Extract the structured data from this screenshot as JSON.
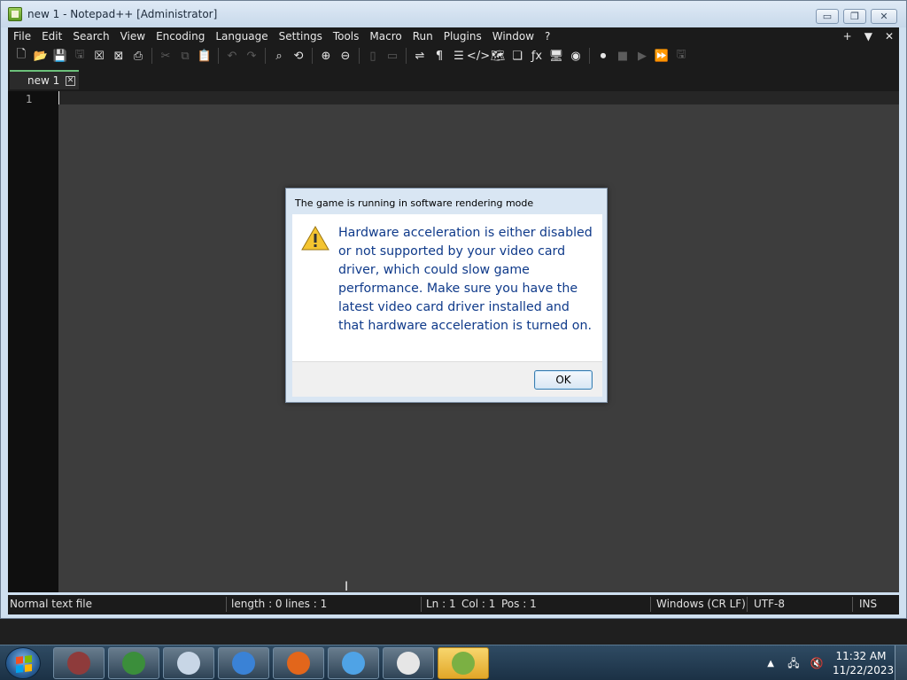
{
  "window": {
    "title": "new 1 - Notepad++ [Administrator]",
    "minimize_glyph": "▭",
    "restore_glyph": "❐",
    "close_glyph": "✕"
  },
  "menu": {
    "items": [
      "File",
      "Edit",
      "Search",
      "View",
      "Encoding",
      "Language",
      "Settings",
      "Tools",
      "Macro",
      "Run",
      "Plugins",
      "Window",
      "?"
    ],
    "right_items": [
      "+",
      "▼",
      "✕"
    ]
  },
  "toolbar": {
    "icons": [
      {
        "name": "new-file-icon",
        "glyph": "🗋",
        "dim": false
      },
      {
        "name": "open-file-icon",
        "glyph": "📂",
        "dim": false
      },
      {
        "name": "save-icon",
        "glyph": "💾",
        "dim": true
      },
      {
        "name": "save-all-icon",
        "glyph": "🖫",
        "dim": true
      },
      {
        "name": "close-icon",
        "glyph": "☒",
        "dim": false
      },
      {
        "name": "close-all-icon",
        "glyph": "⊠",
        "dim": false
      },
      {
        "name": "print-icon",
        "glyph": "⎙",
        "dim": false
      },
      {
        "name": "sep",
        "glyph": "",
        "dim": false
      },
      {
        "name": "cut-icon",
        "glyph": "✂",
        "dim": true
      },
      {
        "name": "copy-icon",
        "glyph": "⧉",
        "dim": true
      },
      {
        "name": "paste-icon",
        "glyph": "📋",
        "dim": true
      },
      {
        "name": "sep",
        "glyph": "",
        "dim": false
      },
      {
        "name": "undo-icon",
        "glyph": "↶",
        "dim": true
      },
      {
        "name": "redo-icon",
        "glyph": "↷",
        "dim": true
      },
      {
        "name": "sep",
        "glyph": "",
        "dim": false
      },
      {
        "name": "find-icon",
        "glyph": "⌕",
        "dim": false
      },
      {
        "name": "replace-icon",
        "glyph": "⟲",
        "dim": false
      },
      {
        "name": "sep",
        "glyph": "",
        "dim": false
      },
      {
        "name": "zoom-in-icon",
        "glyph": "⊕",
        "dim": false
      },
      {
        "name": "zoom-out-icon",
        "glyph": "⊖",
        "dim": false
      },
      {
        "name": "sep",
        "glyph": "",
        "dim": false
      },
      {
        "name": "sync-vertical-icon",
        "glyph": "▯",
        "dim": true
      },
      {
        "name": "sync-horizontal-icon",
        "glyph": "▭",
        "dim": true
      },
      {
        "name": "sep",
        "glyph": "",
        "dim": false
      },
      {
        "name": "word-wrap-icon",
        "glyph": "⇌",
        "dim": false
      },
      {
        "name": "show-all-chars-icon",
        "glyph": "¶",
        "dim": false
      },
      {
        "name": "indent-guide-icon",
        "glyph": "☰",
        "dim": false
      },
      {
        "name": "xml-tag-icon",
        "glyph": "</>",
        "dim": false
      },
      {
        "name": "document-map-icon",
        "glyph": "🗺",
        "dim": false
      },
      {
        "name": "document-list-icon",
        "glyph": "❏",
        "dim": false
      },
      {
        "name": "function-list-icon",
        "glyph": "ƒx",
        "dim": false
      },
      {
        "name": "folder-workspace-icon",
        "glyph": "🖥",
        "dim": false
      },
      {
        "name": "monitoring-icon",
        "glyph": "◉",
        "dim": false
      },
      {
        "name": "sep",
        "glyph": "",
        "dim": false
      },
      {
        "name": "record-macro-icon",
        "glyph": "⏺",
        "dim": false
      },
      {
        "name": "stop-macro-icon",
        "glyph": "■",
        "dim": true
      },
      {
        "name": "play-macro-icon",
        "glyph": "▶",
        "dim": true
      },
      {
        "name": "run-macro-multiple-icon",
        "glyph": "⏩",
        "dim": false
      },
      {
        "name": "save-macro-icon",
        "glyph": "🖫",
        "dim": true
      }
    ]
  },
  "tab": {
    "label": "new 1",
    "close_glyph": "✕"
  },
  "editor": {
    "line_number": "1",
    "cursor_glyph": "I"
  },
  "status": {
    "file_type": "Normal text file",
    "length": "length : 0",
    "lines": "lines : 1",
    "ln": "Ln : 1",
    "col": "Col : 1",
    "pos": "Pos : 1",
    "eol": "Windows (CR LF)",
    "encoding": "UTF-8",
    "mode": "INS"
  },
  "dialog": {
    "title": "The game is running in software rendering mode",
    "message": "Hardware acceleration is either disabled or not supported by your video card driver, which could slow game performance. Make sure you have the latest video card driver installed and that hardware acceleration is turned on.",
    "ok_label": "OK",
    "icon": "warning-icon"
  },
  "taskbar": {
    "apps": [
      {
        "name": "winrar-taskbar-icon",
        "color": "#8e3b3b",
        "active": false
      },
      {
        "name": "chrome-taskbar-icon",
        "color": "#3b8e3b",
        "active": false
      },
      {
        "name": "drive-taskbar-icon",
        "color": "#c8d6e6",
        "active": false
      },
      {
        "name": "internet-explorer-taskbar-icon",
        "color": "#3a82d6",
        "active": false
      },
      {
        "name": "firefox-taskbar-icon",
        "color": "#e2661b",
        "active": false
      },
      {
        "name": "itunes-taskbar-icon",
        "color": "#4fa3e6",
        "active": false
      },
      {
        "name": "solitaire-taskbar-icon",
        "color": "#e6e6e6",
        "active": false
      },
      {
        "name": "notepadpp-taskbar-icon",
        "color": "#7bb043",
        "active": true
      }
    ],
    "time": "11:32 AM",
    "date": "11/22/2023",
    "tray_arrow": "▲",
    "network_glyph": "🖧",
    "volume_glyph": "🔇"
  }
}
